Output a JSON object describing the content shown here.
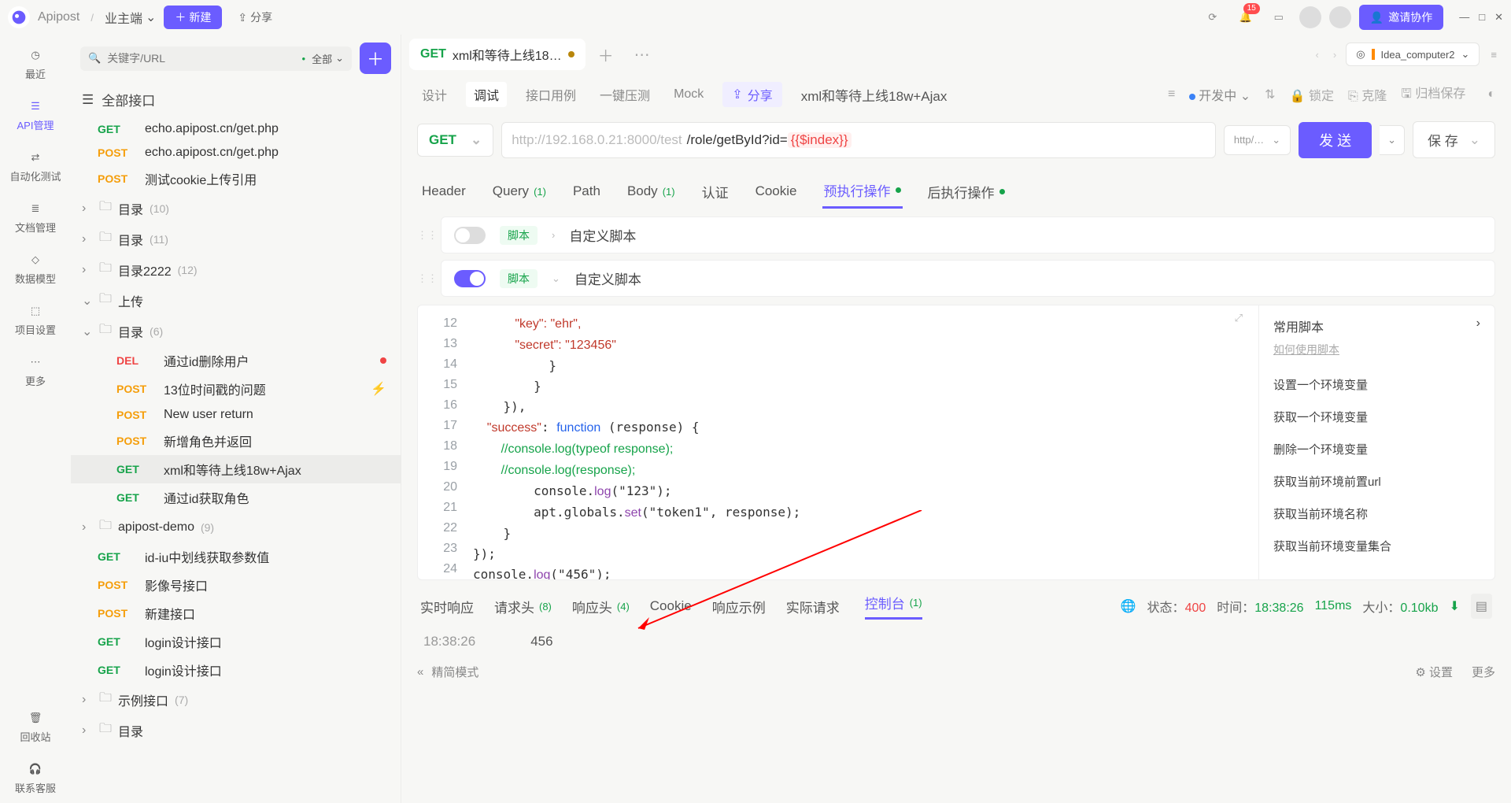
{
  "titlebar": {
    "brand": "Apipost",
    "crumb": "业主端",
    "new": "新建",
    "share": "分享",
    "notif_count": "15",
    "invite": "邀请协作"
  },
  "rail": {
    "recent": "最近",
    "api": "API管理",
    "auto": "自动化测试",
    "docs": "文档管理",
    "model": "数据模型",
    "proj": "项目设置",
    "more": "更多",
    "trash": "回收站",
    "support": "联系客服"
  },
  "sidebar": {
    "search_ph": "关键字/URL",
    "filter": "全部",
    "all": "全部接口",
    "items": [
      {
        "m": "GET",
        "mc": "m-get",
        "label": "echo.apipost.cn/get.php"
      },
      {
        "m": "POST",
        "mc": "m-post",
        "label": "echo.apipost.cn/get.php"
      },
      {
        "m": "POST",
        "mc": "m-post",
        "label": "测试cookie上传引用"
      }
    ],
    "dirs": [
      {
        "label": "目录",
        "count": "(10)",
        "open": false
      },
      {
        "label": "目录",
        "count": "(11)",
        "open": false
      },
      {
        "label": "目录2222",
        "count": "(12)",
        "open": false
      },
      {
        "label": "上传",
        "count": "",
        "open": true
      },
      {
        "label": "目录",
        "count": "(6)",
        "open": true
      }
    ],
    "dir5": [
      {
        "m": "DEL",
        "mc": "m-del",
        "label": "通过id删除用户",
        "flag": "dot"
      },
      {
        "m": "POST",
        "mc": "m-post",
        "label": "13位时间戳的问题",
        "flag": "bolt"
      },
      {
        "m": "POST",
        "mc": "m-post",
        "label": "New user return"
      },
      {
        "m": "POST",
        "mc": "m-post",
        "label": "新增角色并返回"
      },
      {
        "m": "GET",
        "mc": "m-get",
        "label": "xml和等待上线18w+Ajax",
        "sel": true
      },
      {
        "m": "GET",
        "mc": "m-get",
        "label": "通过id获取角色"
      }
    ],
    "dir_demo": {
      "label": "apipost-demo",
      "count": "(9)"
    },
    "demo_items": [
      {
        "m": "GET",
        "mc": "m-get",
        "label": "id-iu中划线获取参数值"
      },
      {
        "m": "POST",
        "mc": "m-post",
        "label": "影像号接口"
      },
      {
        "m": "POST",
        "mc": "m-post",
        "label": "新建接口"
      },
      {
        "m": "GET",
        "mc": "m-get",
        "label": "login设计接口"
      },
      {
        "m": "GET",
        "mc": "m-get",
        "label": "login设计接口"
      }
    ],
    "dir_ex": {
      "label": "示例接口",
      "count": "(7)"
    },
    "dir_last": {
      "label": "目录"
    }
  },
  "tab": {
    "method": "GET",
    "title": "xml和等待上线18…",
    "env": "Idea_computer2"
  },
  "sub": {
    "design": "设计",
    "debug": "调试",
    "cases": "接口用例",
    "stress": "一键压测",
    "mock": "Mock",
    "share": "分享",
    "name": "xml和等待上线18w+Ajax",
    "dev": "开发中",
    "lock": "锁定",
    "clone": "克隆",
    "archive": "归档保存"
  },
  "req": {
    "method": "GET",
    "env_url": "http://192.168.0.21:8000/test",
    "path": "/role/getById?id=",
    "var": "{{$index}}",
    "proto": "http/…",
    "send": "发 送",
    "save": "保 存"
  },
  "reqtabs": {
    "header": "Header",
    "query": "Query",
    "query_n": "(1)",
    "path": "Path",
    "body": "Body",
    "body_n": "(1)",
    "auth": "认证",
    "cookie": "Cookie",
    "pre": "预执行操作",
    "post": "后执行操作"
  },
  "scripts": {
    "chip": "脚本",
    "custom": "自定义脚本"
  },
  "code": {
    "lines": [
      "12",
      "13",
      "14",
      "15",
      "16",
      "17",
      "18",
      "19",
      "20",
      "21",
      "22",
      "23",
      "24"
    ],
    "l12": "            \"key\": \"ehr\",",
    "l13": "            \"secret\": \"123456\"",
    "l14": "          }",
    "l15": "        }",
    "l16": "    }),",
    "l17a": "    \"success\"",
    "l17b": ": ",
    "l17c": "function",
    "l17d": " (response) {",
    "l18": "        //console.log(typeof response);",
    "l19": "        //console.log(response);",
    "l20a": "        console.",
    "l20b": "log",
    "l20c": "(\"123\");",
    "l21a": "        apt.globals.",
    "l21b": "set",
    "l21c": "(\"token1\", response);",
    "l22": "    }",
    "l23": "});",
    "l24a": "console.",
    "l24b": "log",
    "l24c": "(\"456\");"
  },
  "snips": {
    "title": "常用脚本",
    "hint": "如何使用脚本",
    "items": [
      "设置一个环境变量",
      "获取一个环境变量",
      "删除一个环境变量",
      "获取当前环境前置url",
      "获取当前环境名称",
      "获取当前环境变量集合"
    ]
  },
  "resp": {
    "tabs": {
      "live": "实时响应",
      "reqh": "请求头",
      "reqh_n": "(8)",
      "resph": "响应头",
      "resph_n": "(4)",
      "cookie": "Cookie",
      "sample": "响应示例",
      "actual": "实际请求",
      "console": "控制台",
      "console_n": "(1)"
    },
    "status_lbl": "状态：",
    "status_code": "400",
    "time_lbl": "时间：",
    "time": "18:38:26",
    "dur": "115ms",
    "size_lbl": "大小：",
    "size": "0.10kb"
  },
  "console": {
    "ts": "18:38:26",
    "val": "456"
  },
  "footer": {
    "mode": "精简模式",
    "settings": "设置",
    "more": "更多"
  }
}
